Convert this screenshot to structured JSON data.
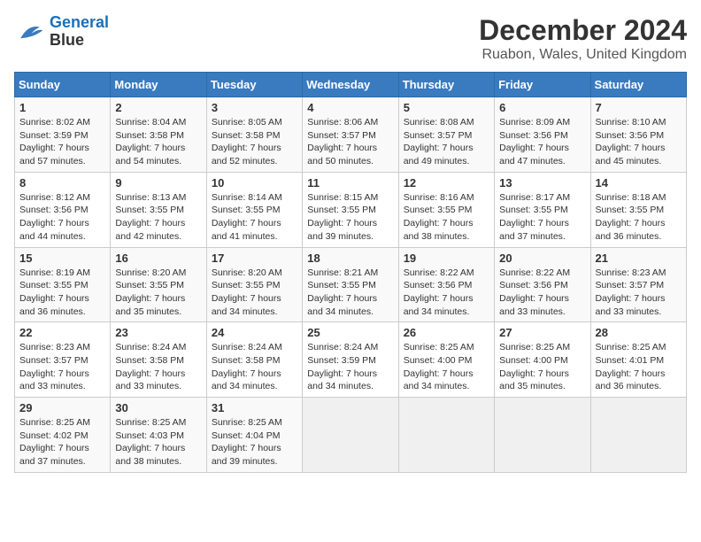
{
  "header": {
    "logo_line1": "General",
    "logo_line2": "Blue",
    "title": "December 2024",
    "subtitle": "Ruabon, Wales, United Kingdom"
  },
  "weekdays": [
    "Sunday",
    "Monday",
    "Tuesday",
    "Wednesday",
    "Thursday",
    "Friday",
    "Saturday"
  ],
  "weeks": [
    [
      {
        "day": "1",
        "sunrise": "8:02 AM",
        "sunset": "3:59 PM",
        "daylight": "7 hours and 57 minutes."
      },
      {
        "day": "2",
        "sunrise": "8:04 AM",
        "sunset": "3:58 PM",
        "daylight": "7 hours and 54 minutes."
      },
      {
        "day": "3",
        "sunrise": "8:05 AM",
        "sunset": "3:58 PM",
        "daylight": "7 hours and 52 minutes."
      },
      {
        "day": "4",
        "sunrise": "8:06 AM",
        "sunset": "3:57 PM",
        "daylight": "7 hours and 50 minutes."
      },
      {
        "day": "5",
        "sunrise": "8:08 AM",
        "sunset": "3:57 PM",
        "daylight": "7 hours and 49 minutes."
      },
      {
        "day": "6",
        "sunrise": "8:09 AM",
        "sunset": "3:56 PM",
        "daylight": "7 hours and 47 minutes."
      },
      {
        "day": "7",
        "sunrise": "8:10 AM",
        "sunset": "3:56 PM",
        "daylight": "7 hours and 45 minutes."
      }
    ],
    [
      {
        "day": "8",
        "sunrise": "8:12 AM",
        "sunset": "3:56 PM",
        "daylight": "7 hours and 44 minutes."
      },
      {
        "day": "9",
        "sunrise": "8:13 AM",
        "sunset": "3:55 PM",
        "daylight": "7 hours and 42 minutes."
      },
      {
        "day": "10",
        "sunrise": "8:14 AM",
        "sunset": "3:55 PM",
        "daylight": "7 hours and 41 minutes."
      },
      {
        "day": "11",
        "sunrise": "8:15 AM",
        "sunset": "3:55 PM",
        "daylight": "7 hours and 39 minutes."
      },
      {
        "day": "12",
        "sunrise": "8:16 AM",
        "sunset": "3:55 PM",
        "daylight": "7 hours and 38 minutes."
      },
      {
        "day": "13",
        "sunrise": "8:17 AM",
        "sunset": "3:55 PM",
        "daylight": "7 hours and 37 minutes."
      },
      {
        "day": "14",
        "sunrise": "8:18 AM",
        "sunset": "3:55 PM",
        "daylight": "7 hours and 36 minutes."
      }
    ],
    [
      {
        "day": "15",
        "sunrise": "8:19 AM",
        "sunset": "3:55 PM",
        "daylight": "7 hours and 36 minutes."
      },
      {
        "day": "16",
        "sunrise": "8:20 AM",
        "sunset": "3:55 PM",
        "daylight": "7 hours and 35 minutes."
      },
      {
        "day": "17",
        "sunrise": "8:20 AM",
        "sunset": "3:55 PM",
        "daylight": "7 hours and 34 minutes."
      },
      {
        "day": "18",
        "sunrise": "8:21 AM",
        "sunset": "3:55 PM",
        "daylight": "7 hours and 34 minutes."
      },
      {
        "day": "19",
        "sunrise": "8:22 AM",
        "sunset": "3:56 PM",
        "daylight": "7 hours and 34 minutes."
      },
      {
        "day": "20",
        "sunrise": "8:22 AM",
        "sunset": "3:56 PM",
        "daylight": "7 hours and 33 minutes."
      },
      {
        "day": "21",
        "sunrise": "8:23 AM",
        "sunset": "3:57 PM",
        "daylight": "7 hours and 33 minutes."
      }
    ],
    [
      {
        "day": "22",
        "sunrise": "8:23 AM",
        "sunset": "3:57 PM",
        "daylight": "7 hours and 33 minutes."
      },
      {
        "day": "23",
        "sunrise": "8:24 AM",
        "sunset": "3:58 PM",
        "daylight": "7 hours and 33 minutes."
      },
      {
        "day": "24",
        "sunrise": "8:24 AM",
        "sunset": "3:58 PM",
        "daylight": "7 hours and 34 minutes."
      },
      {
        "day": "25",
        "sunrise": "8:24 AM",
        "sunset": "3:59 PM",
        "daylight": "7 hours and 34 minutes."
      },
      {
        "day": "26",
        "sunrise": "8:25 AM",
        "sunset": "4:00 PM",
        "daylight": "7 hours and 34 minutes."
      },
      {
        "day": "27",
        "sunrise": "8:25 AM",
        "sunset": "4:00 PM",
        "daylight": "7 hours and 35 minutes."
      },
      {
        "day": "28",
        "sunrise": "8:25 AM",
        "sunset": "4:01 PM",
        "daylight": "7 hours and 36 minutes."
      }
    ],
    [
      {
        "day": "29",
        "sunrise": "8:25 AM",
        "sunset": "4:02 PM",
        "daylight": "7 hours and 37 minutes."
      },
      {
        "day": "30",
        "sunrise": "8:25 AM",
        "sunset": "4:03 PM",
        "daylight": "7 hours and 38 minutes."
      },
      {
        "day": "31",
        "sunrise": "8:25 AM",
        "sunset": "4:04 PM",
        "daylight": "7 hours and 39 minutes."
      },
      null,
      null,
      null,
      null
    ]
  ]
}
